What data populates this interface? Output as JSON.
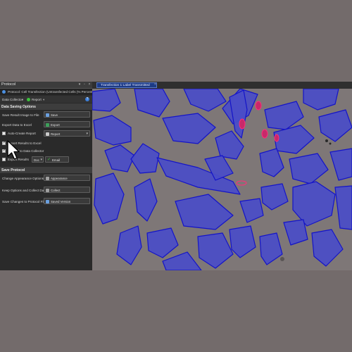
{
  "panel": {
    "title": "Protocol",
    "protocol_name": "Protocol: Cell Transfection (Untransfected Cells (% Percent))",
    "toolbar": {
      "collector": "Data Collector",
      "report": "Report"
    },
    "sections": {
      "data_saving": "Data Saving Options",
      "save_protocol": "Save Protocol"
    },
    "rows": {
      "save_image": "Save Result Image to File",
      "export_excel": "Export Data to Excel",
      "auto_report": "Auto-Create Report",
      "export_results_excel": "Export Results to Excel",
      "append_collector": "Append to Data Collector",
      "export_results": "Export Results",
      "change_appearance": "Change Appearance Options",
      "keep_options": "Keep Options and Collect Data",
      "save_changes": "Save Changes to Protocol File"
    },
    "buttons": {
      "save": "Save",
      "export": "Export",
      "report": "Report",
      "email": "Email",
      "format": "Doc",
      "appearance": "Appearance",
      "collect": "Collect",
      "saved_version": "Saved Version"
    },
    "checks": {
      "auto_report": false,
      "export_results_excel": true,
      "append_collector": true,
      "export_results": false
    }
  },
  "tab": {
    "label": "Transfection 1 Label Transmitted"
  },
  "colors": {
    "cell_fill": "#4a4ec7",
    "cell_edge": "#1414c8",
    "transfected": "#d02a6a",
    "background": "#7e7777"
  }
}
